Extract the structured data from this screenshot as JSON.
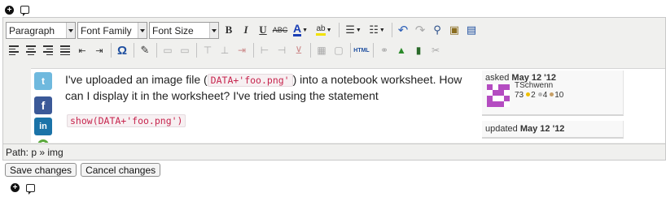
{
  "top_icons": [
    "add-icon",
    "comment-icon"
  ],
  "toolbar": {
    "format_select": "Paragraph",
    "font_family_select": "Font Family",
    "font_size_select": "Font Size",
    "bold_label": "B",
    "italic_label": "I",
    "underline_label": "U",
    "strike_label": "ABC",
    "forecolor_label": "A",
    "forecolor_accent": "#1a3fb5",
    "highlight_label": "ab",
    "highlight_accent": "#f2e200",
    "charmap_label": "Ω",
    "html_label": "HTML"
  },
  "content": {
    "paragraph_before": "I've uploaded an image file (",
    "code_inline": "DATA+'foo.png'",
    "paragraph_after": ") into a notebook worksheet. How can I display it in the worksheet? I've tried using the statement",
    "code_block": "show(DATA+'foo.png')",
    "social": {
      "twitter": "t",
      "facebook": "f",
      "linkedin": "in"
    }
  },
  "asked_card": {
    "prefix": "asked",
    "date": "May 12 '12",
    "user": "TSchwenn",
    "reputation": "73",
    "gold": "2",
    "silver": "4",
    "bronze": "10"
  },
  "updated_card": {
    "prefix": "updated",
    "date": "May 12 '12"
  },
  "path_bar": "Path: p » img",
  "actions": {
    "save": "Save changes",
    "cancel": "Cancel changes"
  },
  "colors": {
    "avatar": "#b44cc1",
    "code_text": "#c7254e",
    "twitter": "#6fb9de",
    "facebook": "#3b5998",
    "linkedin": "#1b73a8"
  }
}
